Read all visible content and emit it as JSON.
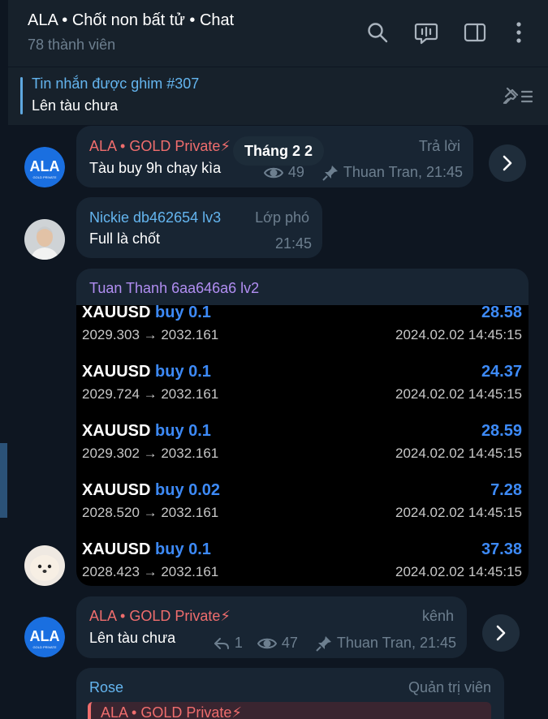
{
  "header": {
    "title": "ALA • Chốt non bất tử • Chat",
    "subtitle": "78 thành viên"
  },
  "pinned": {
    "title": "Tin nhắn được ghim #307",
    "text": "Lên tàu chưa"
  },
  "date_chip": "Tháng 2 2",
  "messages": [
    {
      "sender": "ALA • GOLD Private",
      "sender_suffix": "⚡",
      "text": "Tàu buy 9h chạy kìa",
      "tag": "Trả lời",
      "views": "49",
      "author_time": "Thuan Tran, 21:45"
    },
    {
      "sender": "Nickie db462654 lv3",
      "tag": "Lớp phó",
      "text": "Full là chốt",
      "time": "21:45"
    },
    {
      "sender": "Tuan Thanh 6aa646a6 lv2",
      "trades": [
        {
          "symbol": "XAUUSD",
          "direction": "buy 0.1",
          "profit": "28.58",
          "prices": "2029.303 → 2032.161",
          "datetime": "2024.02.02 14:45:15"
        },
        {
          "symbol": "XAUUSD",
          "direction": "buy 0.1",
          "profit": "24.37",
          "prices": "2029.724 → 2032.161",
          "datetime": "2024.02.02 14:45:15"
        },
        {
          "symbol": "XAUUSD",
          "direction": "buy 0.1",
          "profit": "28.59",
          "prices": "2029.302 → 2032.161",
          "datetime": "2024.02.02 14:45:15"
        },
        {
          "symbol": "XAUUSD",
          "direction": "buy 0.02",
          "profit": "7.28",
          "prices": "2028.520 → 2032.161",
          "datetime": "2024.02.02 14:45:15"
        },
        {
          "symbol": "XAUUSD",
          "direction": "buy 0.1",
          "profit": "37.38",
          "prices": "2028.423 → 2032.161",
          "datetime": "2024.02.02 14:45:15"
        }
      ]
    },
    {
      "sender": "ALA • GOLD Private",
      "sender_suffix": "⚡",
      "tag": "kênh",
      "text": "Lên tàu chưa",
      "replies": "1",
      "views": "47",
      "author_time": "Thuan Tran, 21:45"
    },
    {
      "sender": "Rose",
      "tag": "Quản trị viên",
      "quote_sender": "ALA • GOLD Private",
      "quote_suffix": "⚡"
    }
  ],
  "avatars": {
    "ala_logo_text": "ALA",
    "ala_logo_subtext": "GOLD PRIVATE"
  },
  "colors": {
    "background": "#0e1621",
    "panel": "#17212b",
    "bubble": "#182533",
    "ala_red": "#ef6d6d",
    "blue_name": "#64b5ef",
    "purple_name": "#b18ef2",
    "link_blue": "#3d8af7",
    "muted": "#6d7f8f"
  }
}
